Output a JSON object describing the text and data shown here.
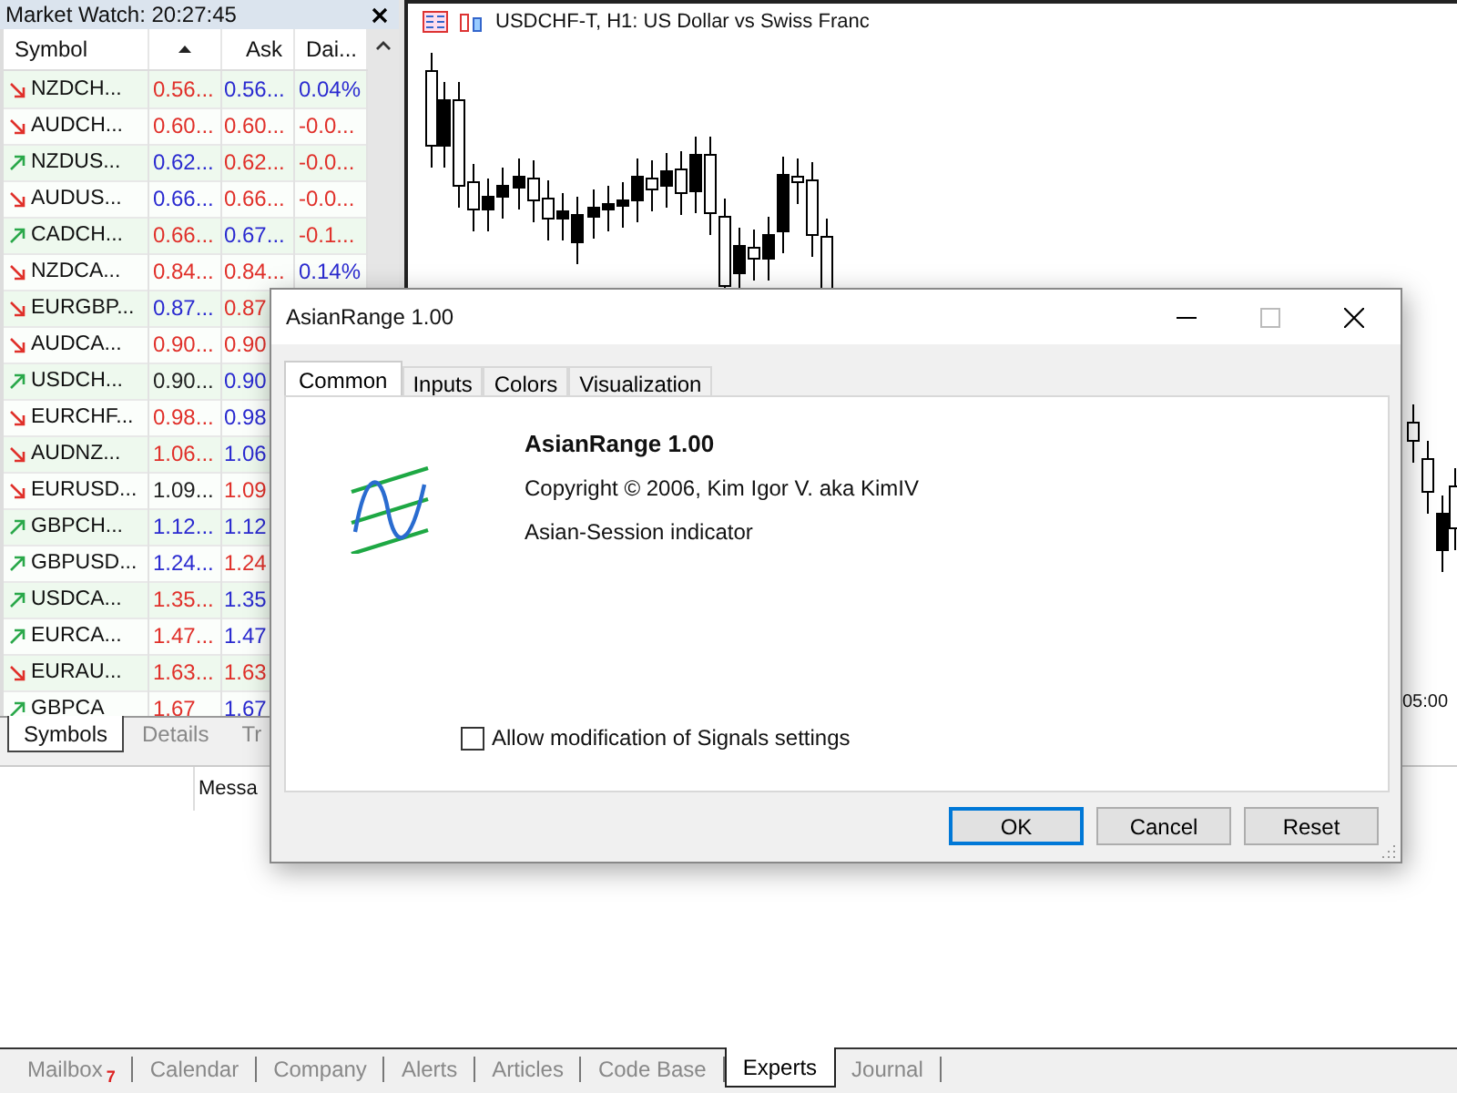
{
  "market_watch": {
    "title": "Market Watch: 20:27:45",
    "columns": {
      "symbol": "Symbol",
      "ask": "Ask",
      "daily": "Dai..."
    },
    "rows": [
      {
        "rising": false,
        "symbol": "NZDCH...",
        "bid": {
          "text": "0.56...",
          "color": "#e0302a"
        },
        "ask": {
          "text": "0.56...",
          "color": "#2a2ad0"
        },
        "daily": {
          "text": "0.04%",
          "color": "#2a2ad0"
        }
      },
      {
        "rising": false,
        "symbol": "AUDCH...",
        "bid": {
          "text": "0.60...",
          "color": "#e0302a"
        },
        "ask": {
          "text": "0.60...",
          "color": "#e0302a"
        },
        "daily": {
          "text": "-0.0...",
          "color": "#e0302a"
        }
      },
      {
        "rising": true,
        "symbol": "NZDUS...",
        "bid": {
          "text": "0.62...",
          "color": "#2a2ad0"
        },
        "ask": {
          "text": "0.62...",
          "color": "#e0302a"
        },
        "daily": {
          "text": "-0.0...",
          "color": "#e0302a"
        }
      },
      {
        "rising": false,
        "symbol": "AUDUS...",
        "bid": {
          "text": "0.66...",
          "color": "#2a2ad0"
        },
        "ask": {
          "text": "0.66...",
          "color": "#e0302a"
        },
        "daily": {
          "text": "-0.0...",
          "color": "#e0302a"
        }
      },
      {
        "rising": true,
        "symbol": "CADCH...",
        "bid": {
          "text": "0.66...",
          "color": "#e0302a"
        },
        "ask": {
          "text": "0.67...",
          "color": "#2a2ad0"
        },
        "daily": {
          "text": "-0.1...",
          "color": "#e0302a"
        }
      },
      {
        "rising": false,
        "symbol": "NZDCA...",
        "bid": {
          "text": "0.84...",
          "color": "#e0302a"
        },
        "ask": {
          "text": "0.84...",
          "color": "#e0302a"
        },
        "daily": {
          "text": "0.14%",
          "color": "#2a2ad0"
        }
      },
      {
        "rising": false,
        "symbol": "EURGBP...",
        "bid": {
          "text": "0.87...",
          "color": "#2a2ad0"
        },
        "ask": {
          "text": "0.87",
          "color": "#e0302a"
        }
      },
      {
        "rising": false,
        "symbol": "AUDCA...",
        "bid": {
          "text": "0.90...",
          "color": "#e0302a"
        },
        "ask": {
          "text": "0.90",
          "color": "#e0302a"
        }
      },
      {
        "rising": true,
        "symbol": "USDCH...",
        "bid": {
          "text": "0.90...",
          "color": "#222222"
        },
        "ask": {
          "text": "0.90",
          "color": "#2a2ad0"
        }
      },
      {
        "rising": false,
        "symbol": "EURCHF...",
        "bid": {
          "text": "0.98...",
          "color": "#e0302a"
        },
        "ask": {
          "text": "0.98",
          "color": "#2a2ad0"
        }
      },
      {
        "rising": false,
        "symbol": "AUDNZ...",
        "bid": {
          "text": "1.06...",
          "color": "#e0302a"
        },
        "ask": {
          "text": "1.06",
          "color": "#2a2ad0"
        }
      },
      {
        "rising": false,
        "symbol": "EURUSD...",
        "bid": {
          "text": "1.09...",
          "color": "#222222"
        },
        "ask": {
          "text": "1.09",
          "color": "#e0302a"
        }
      },
      {
        "rising": true,
        "symbol": "GBPCH...",
        "bid": {
          "text": "1.12...",
          "color": "#2a2ad0"
        },
        "ask": {
          "text": "1.12",
          "color": "#2a2ad0"
        }
      },
      {
        "rising": true,
        "symbol": "GBPUSD...",
        "bid": {
          "text": "1.24...",
          "color": "#2a2ad0"
        },
        "ask": {
          "text": "1.24",
          "color": "#e0302a"
        }
      },
      {
        "rising": true,
        "symbol": "USDCA...",
        "bid": {
          "text": "1.35...",
          "color": "#e0302a"
        },
        "ask": {
          "text": "1.35",
          "color": "#2a2ad0"
        }
      },
      {
        "rising": true,
        "symbol": "EURCA...",
        "bid": {
          "text": "1.47...",
          "color": "#e0302a"
        },
        "ask": {
          "text": "1.47",
          "color": "#2a2ad0"
        }
      },
      {
        "rising": false,
        "symbol": "EURAU...",
        "bid": {
          "text": "1.63...",
          "color": "#e0302a"
        },
        "ask": {
          "text": "1.63",
          "color": "#e0302a"
        }
      },
      {
        "rising": true,
        "symbol": "GBPCA",
        "bid": {
          "text": "1.67",
          "color": "#e0302a"
        },
        "ask": {
          "text": "1.67",
          "color": "#2a2ad0"
        }
      }
    ],
    "tabs": [
      {
        "label": "Symbols",
        "selected": true
      },
      {
        "label": "Details",
        "selected": false
      },
      {
        "label": "Tr",
        "selected": false
      }
    ]
  },
  "chart": {
    "title": "USDCHF-T, H1:  US Dollar vs Swiss Franc",
    "time_label": "05:00"
  },
  "toolbox": {
    "column_header": "Messa",
    "tabs": [
      {
        "label": "Mailbox",
        "badge": "7",
        "selected": false
      },
      {
        "label": "Calendar",
        "selected": false
      },
      {
        "label": "Company",
        "selected": false
      },
      {
        "label": "Alerts",
        "selected": false
      },
      {
        "label": "Articles",
        "selected": false
      },
      {
        "label": "Code Base",
        "selected": false
      },
      {
        "label": "Experts",
        "selected": true
      },
      {
        "label": "Journal",
        "selected": false
      }
    ]
  },
  "dialog": {
    "title": "AsianRange 1.00",
    "tabs": [
      {
        "label": "Common",
        "selected": true
      },
      {
        "label": "Inputs",
        "selected": false
      },
      {
        "label": "Colors",
        "selected": false
      },
      {
        "label": "Visualization",
        "selected": false
      }
    ],
    "name": "AsianRange 1.00",
    "copyright": "Copyright © 2006, Kim Igor V. aka KimIV",
    "description": "Asian-Session indicator",
    "checkbox": {
      "label": "Allow modification of Signals settings",
      "checked": false
    },
    "buttons": [
      {
        "label": "OK",
        "default": true
      },
      {
        "label": "Cancel",
        "default": false
      },
      {
        "label": "Reset",
        "default": false
      }
    ]
  }
}
